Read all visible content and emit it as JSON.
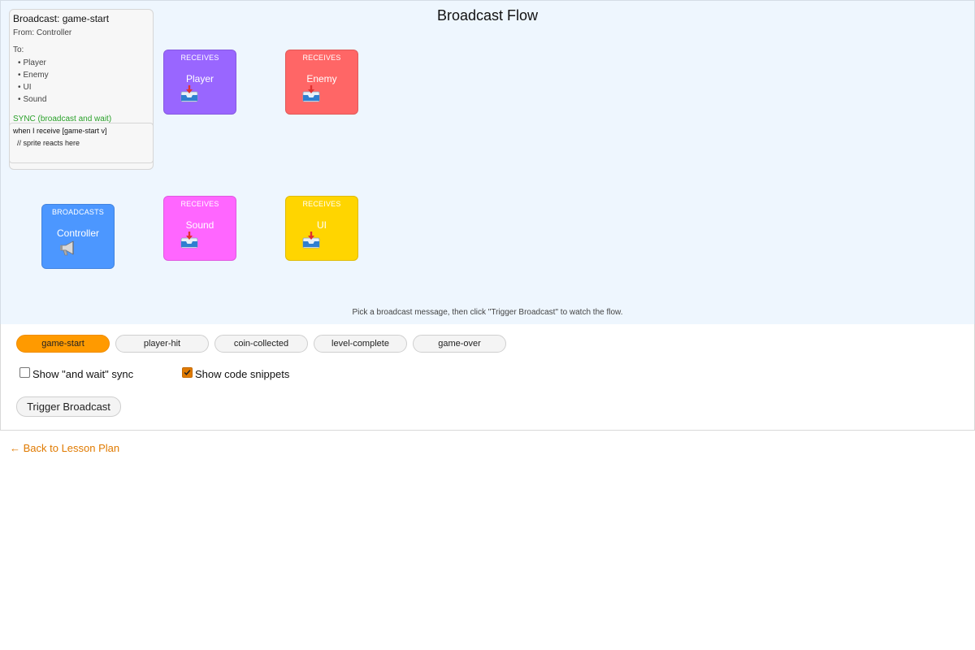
{
  "stage": {
    "title": "Broadcast Flow",
    "hint": "Pick a broadcast message, then click \"Trigger Broadcast\" to watch the flow."
  },
  "info": {
    "title": "Broadcast: game-start",
    "from": "From: Controller",
    "to_label": "To:",
    "recipients": [
      "Player",
      "Enemy",
      "UI",
      "Sound"
    ],
    "sync": "SYNC (broadcast and wait)",
    "code_line1": "when I receive [game-start v]",
    "code_line2": "// sprite reacts here"
  },
  "sprites": [
    {
      "role": "RECEIVES",
      "name": "Player",
      "color": "#9966ff",
      "icon": "inbox-icon"
    },
    {
      "role": "RECEIVES",
      "name": "Enemy",
      "color": "#ff6666",
      "icon": "inbox-icon"
    },
    {
      "role": "BROADCASTS",
      "name": "Controller",
      "color": "#4c97ff",
      "icon": "megaphone-icon"
    },
    {
      "role": "RECEIVES",
      "name": "Sound",
      "color": "#ff66ff",
      "icon": "inbox-icon"
    },
    {
      "role": "RECEIVES",
      "name": "UI",
      "color": "#ffd500",
      "icon": "inbox-icon"
    }
  ],
  "messages": [
    {
      "label": "game-start",
      "active": true
    },
    {
      "label": "player-hit",
      "active": false
    },
    {
      "label": "coin-collected",
      "active": false
    },
    {
      "label": "level-complete",
      "active": false
    },
    {
      "label": "game-over",
      "active": false
    }
  ],
  "options": {
    "and_wait_label": "Show \"and wait\" sync",
    "and_wait_checked": false,
    "snippets_label": "Show code snippets",
    "snippets_checked": true
  },
  "trigger_label": "Trigger Broadcast",
  "back_link": "← Back to Lesson Plan",
  "colors": {
    "stage_bg": "#eef6fe",
    "accent": "#ff9a00",
    "link": "#e07a00",
    "sync": "#2aa12a"
  }
}
